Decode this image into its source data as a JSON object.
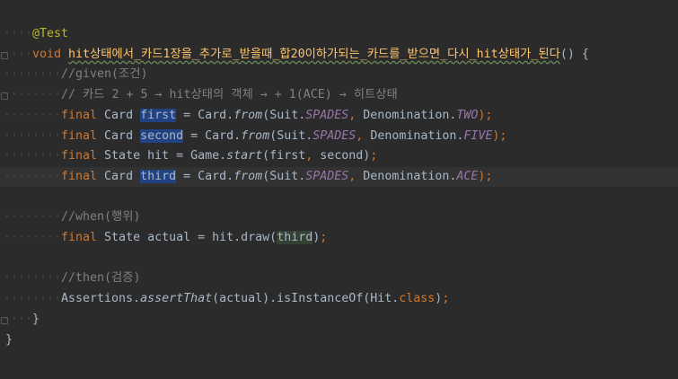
{
  "editor": {
    "lines": [
      {
        "indent": 1,
        "tokens": [
          {
            "t": "@Test",
            "c": "ann"
          }
        ]
      },
      {
        "indent": 1,
        "tokens": [
          {
            "t": "void ",
            "c": "kw"
          },
          {
            "t": "hit상태에서_카드1장을_추가로_받을때_합20이하가되는_카드를_받으면_다시_hit상태가_된다",
            "c": "fn warn"
          },
          {
            "t": "() {",
            "c": ""
          }
        ]
      },
      {
        "indent": 2,
        "tokens": [
          {
            "t": "//given(조건)",
            "c": "cm"
          }
        ]
      },
      {
        "indent": 2,
        "tokens": [
          {
            "t": "// 카드 2 + 5 → hit상태의 객체 → + 1(ACE) → 히트상태",
            "c": "cm"
          }
        ]
      },
      {
        "indent": 2,
        "tokens": [
          {
            "t": "final ",
            "c": "kw"
          },
          {
            "t": "Card ",
            "c": ""
          },
          {
            "t": "first",
            "c": "sel"
          },
          {
            "t": " = Card.",
            "c": ""
          },
          {
            "t": "from",
            "c": "it"
          },
          {
            "t": "(Suit.",
            "c": ""
          },
          {
            "t": "SPADES",
            "c": "const"
          },
          {
            "t": ", ",
            "c": "kw"
          },
          {
            "t": "Denomination.",
            "c": ""
          },
          {
            "t": "TWO",
            "c": "const"
          },
          {
            "t": ");",
            "c": "kw"
          }
        ]
      },
      {
        "indent": 2,
        "tokens": [
          {
            "t": "final ",
            "c": "kw"
          },
          {
            "t": "Card ",
            "c": ""
          },
          {
            "t": "second",
            "c": "sel"
          },
          {
            "t": " = Card.",
            "c": ""
          },
          {
            "t": "from",
            "c": "it"
          },
          {
            "t": "(Suit.",
            "c": ""
          },
          {
            "t": "SPADES",
            "c": "const"
          },
          {
            "t": ", ",
            "c": "kw"
          },
          {
            "t": "Denomination.",
            "c": ""
          },
          {
            "t": "FIVE",
            "c": "const"
          },
          {
            "t": ");",
            "c": "kw"
          }
        ]
      },
      {
        "indent": 2,
        "tokens": [
          {
            "t": "final ",
            "c": "kw"
          },
          {
            "t": "State hit = Game.",
            "c": ""
          },
          {
            "t": "start",
            "c": "it"
          },
          {
            "t": "(first",
            "c": ""
          },
          {
            "t": ", ",
            "c": "kw"
          },
          {
            "t": "second)",
            "c": ""
          },
          {
            "t": ";",
            "c": "kw"
          }
        ]
      },
      {
        "indent": 2,
        "current": true,
        "tokens": [
          {
            "t": "final ",
            "c": "kw"
          },
          {
            "t": "Card ",
            "c": ""
          },
          {
            "t": "third",
            "c": "sel"
          },
          {
            "t": " = Card.",
            "c": ""
          },
          {
            "t": "from",
            "c": "it"
          },
          {
            "t": "(Suit.",
            "c": ""
          },
          {
            "t": "SPADES",
            "c": "const"
          },
          {
            "t": ", ",
            "c": "kw"
          },
          {
            "t": "Denomination.",
            "c": ""
          },
          {
            "t": "ACE",
            "c": "const"
          },
          {
            "t": ");",
            "c": "kw"
          }
        ]
      },
      {
        "indent": 0,
        "tokens": []
      },
      {
        "indent": 2,
        "tokens": [
          {
            "t": "//when(행위)",
            "c": "cm"
          }
        ]
      },
      {
        "indent": 2,
        "tokens": [
          {
            "t": "final ",
            "c": "kw"
          },
          {
            "t": "State actual = hit.draw(",
            "c": ""
          },
          {
            "t": "third",
            "c": "hl2"
          },
          {
            "t": ")",
            "c": ""
          },
          {
            "t": ";",
            "c": "kw"
          }
        ]
      },
      {
        "indent": 0,
        "tokens": []
      },
      {
        "indent": 2,
        "tokens": [
          {
            "t": "//then(검증)",
            "c": "cm"
          }
        ]
      },
      {
        "indent": 2,
        "tokens": [
          {
            "t": "Assertions.",
            "c": ""
          },
          {
            "t": "assertThat",
            "c": "it"
          },
          {
            "t": "(actual).isInstanceOf(Hit.",
            "c": ""
          },
          {
            "t": "class",
            "c": "kw"
          },
          {
            "t": ")",
            "c": ""
          },
          {
            "t": ";",
            "c": "kw"
          }
        ]
      },
      {
        "indent": 1,
        "tokens": [
          {
            "t": "}",
            "c": ""
          }
        ]
      },
      {
        "indent": 0,
        "tokens": [
          {
            "t": "}",
            "c": ""
          }
        ]
      }
    ]
  }
}
